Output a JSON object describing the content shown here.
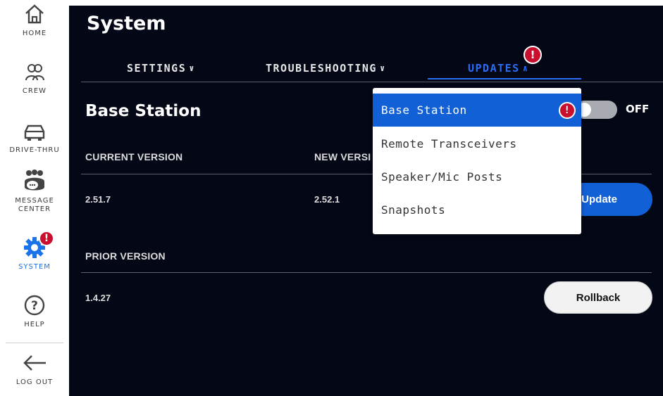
{
  "sidebar": {
    "items": [
      {
        "label": "HOME",
        "icon": "home-icon"
      },
      {
        "label": "CREW",
        "icon": "crew-icon"
      },
      {
        "label": "DRIVE-THRU",
        "icon": "car-icon"
      },
      {
        "label": "MESSAGE CENTER",
        "icon": "message-center-icon"
      },
      {
        "label": "SYSTEM",
        "icon": "gear-icon",
        "active": true,
        "badge": "!"
      },
      {
        "label": "HELP",
        "icon": "help-icon"
      },
      {
        "label": "LOG OUT",
        "icon": "arrow-left-icon"
      }
    ]
  },
  "page": {
    "title": "System"
  },
  "tabs": [
    {
      "label": "SETTINGS",
      "chevron": "⌄"
    },
    {
      "label": "TROUBLESHOOTING",
      "chevron": "⌄"
    },
    {
      "label": "UPDATES",
      "chevron": "^",
      "active": true,
      "badge": "!"
    }
  ],
  "section": {
    "title": "Base Station",
    "toggle_state": "OFF",
    "current_version_label": "CURRENT VERSION",
    "new_version_label": "NEW VERSI",
    "current_version": "2.51.7",
    "new_version": "2.52.1",
    "update_button": "Update",
    "prior_version_label": "PRIOR VERSION",
    "prior_version": "1.4.27",
    "rollback_button": "Rollback"
  },
  "dropdown": {
    "items": [
      {
        "label": "Base Station",
        "selected": true,
        "badge": "!"
      },
      {
        "label": "Remote Transceivers"
      },
      {
        "label": "Speaker/Mic Posts"
      },
      {
        "label": "Snapshots"
      }
    ]
  },
  "colors": {
    "background": "#030716",
    "accent": "#1260d6",
    "alert": "#c8102e"
  }
}
